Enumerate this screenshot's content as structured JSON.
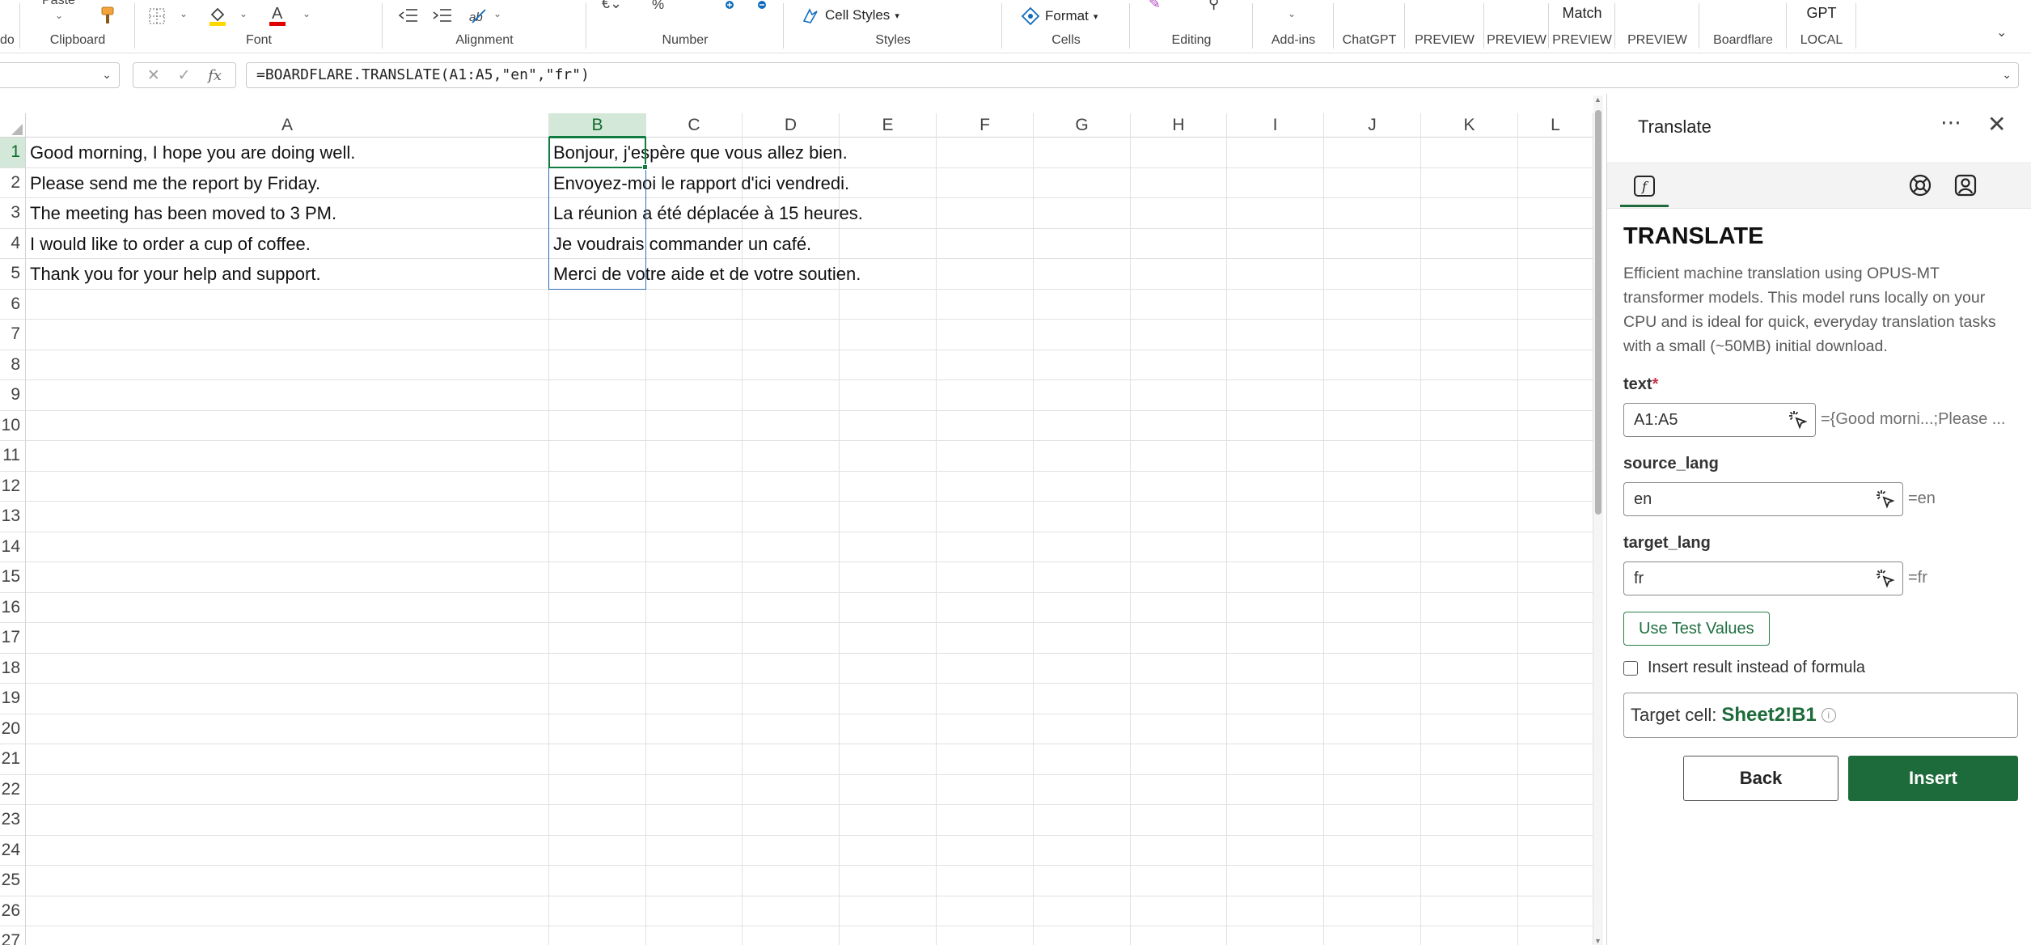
{
  "ribbon": {
    "undo_fragment": "do",
    "paste_label": "Paste",
    "groups": {
      "clipboard": "Clipboard",
      "font": "Font",
      "alignment": "Alignment",
      "number": "Number",
      "styles": "Styles",
      "cells": "Cells",
      "editing": "Editing",
      "addins": "Add-ins",
      "chatgpt": "ChatGPT",
      "preview1": "PREVIEW",
      "preview2": "PREVIEW",
      "preview3": "PREVIEW",
      "preview4": "PREVIEW",
      "boardflare": "Boardflare",
      "local": "LOCAL"
    },
    "cell_styles_label": "Cell Styles",
    "format_label": "Format",
    "match_label": "Match",
    "gpt_label": "GPT",
    "accent_color": "#107c41",
    "font_color_bar": "#e00000",
    "highlight_color_bar": "#ffd800"
  },
  "formula_bar": {
    "name_box": "",
    "fx_symbol": "fx",
    "formula": "=BOARDFLARE.TRANSLATE(A1:A5,\"en\",\"fr\")"
  },
  "grid": {
    "columns": [
      "A",
      "B",
      "C",
      "D",
      "E",
      "F",
      "G",
      "H",
      "I",
      "J",
      "K",
      "L"
    ],
    "rows": [
      "1",
      "2",
      "3",
      "4",
      "5",
      "6",
      "7",
      "8",
      "9",
      "10",
      "11",
      "12",
      "13",
      "14",
      "15",
      "16",
      "17",
      "18",
      "19",
      "20",
      "21",
      "22",
      "23",
      "24",
      "25",
      "26",
      "27"
    ],
    "selected_column": "B",
    "selected_row": "1",
    "column_a": [
      "Good morning, I hope you are doing well.",
      "Please send me the report by Friday.",
      "The meeting has been moved to 3 PM.",
      "I would like to order a cup of coffee.",
      "Thank you for your help and support."
    ],
    "column_b": [
      "Bonjour, j'espère que vous allez bien.",
      "Envoyez-moi le rapport d'ici vendredi.",
      "La réunion a été déplacée à 15 heures.",
      "Je voudrais commander un café.",
      "Merci de votre aide et de votre soutien."
    ]
  },
  "pane": {
    "title": "Translate",
    "more_icon": "more-horizontal-icon",
    "close_icon": "close-icon",
    "function_name": "TRANSLATE",
    "description": "Efficient machine translation using OPUS-MT transformer models. This model runs locally on your CPU and is ideal for quick, everyday translation tasks with a small (~50MB) initial download.",
    "params": {
      "text": {
        "label": "text",
        "required_mark": "*",
        "value": "A1:A5",
        "evaluated": "={Good morni...;Please ..."
      },
      "source_lang": {
        "label": "source_lang",
        "value": "en",
        "evaluated": "=en"
      },
      "target_lang": {
        "label": "target_lang",
        "value": "fr",
        "evaluated": "=fr"
      }
    },
    "test_values_button": "Use Test Values",
    "insert_result_checkbox": "Insert result instead of formula",
    "target_cell_label": "Target cell:",
    "target_cell_value": "Sheet2!B1",
    "info_icon": "i",
    "back_button": "Back",
    "insert_button": "Insert",
    "primary_color": "#1d6b3a"
  }
}
